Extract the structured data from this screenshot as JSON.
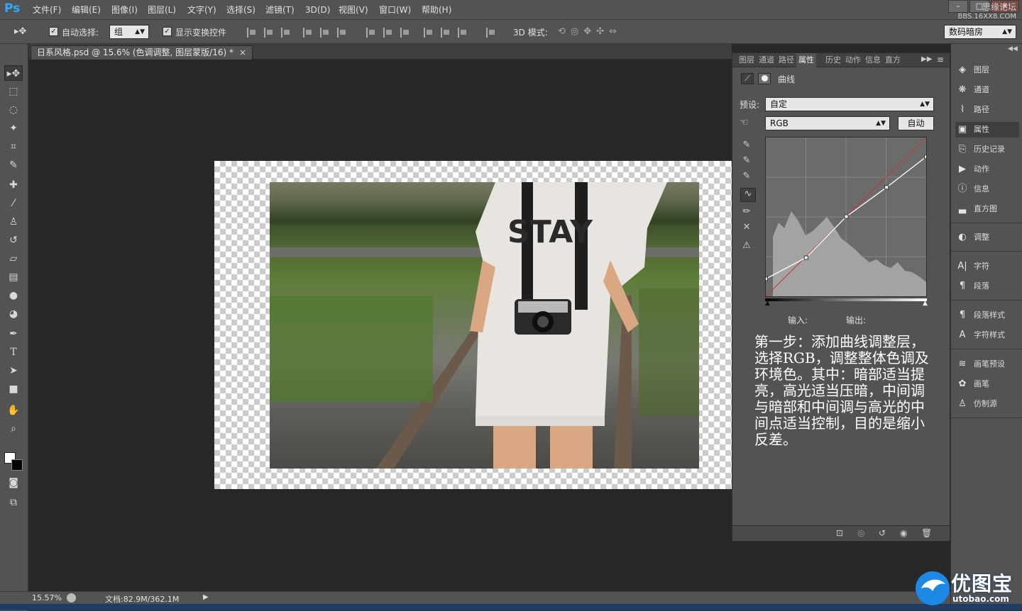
{
  "app": {
    "logo": "Ps"
  },
  "menu": [
    "文件(F)",
    "编辑(E)",
    "图像(I)",
    "图层(L)",
    "文字(Y)",
    "选择(S)",
    "滤镜(T)",
    "3D(D)",
    "视图(V)",
    "窗口(W)",
    "帮助(H)"
  ],
  "window_controls": {
    "minimize": "–",
    "maximize": "□",
    "close": "✕"
  },
  "watermark_top": {
    "line1": "思缘论坛",
    "line2": "BBS.16XX8.COM"
  },
  "options": {
    "auto_select_label": "自动选择:",
    "auto_select_value": "组",
    "show_transform_label": "显示变换控件",
    "mode_3d_label": "3D 模式:",
    "workspace": "数码暗房"
  },
  "document": {
    "tab_title": "日系风格.psd @ 15.6% (色调调整, 图层蒙版/16) *",
    "close": "×"
  },
  "photo": {
    "shirt_text": "STAY"
  },
  "status": {
    "zoom": "15.57%",
    "doc_size": "文档:82.9M/362.1M"
  },
  "properties": {
    "tabs": [
      "图层",
      "通道",
      "路径",
      "属性",
      "历史",
      "动作",
      "信息",
      "直方"
    ],
    "active_tab": "属性",
    "panel_title": "曲线",
    "preset_label": "预设:",
    "preset_value": "自定",
    "channel_value": "RGB",
    "auto_button": "自动",
    "input_label": "输入:",
    "output_label": "输出:",
    "annotation": "第一步：添加曲线调整层，选择RGB，调整整体色调及环境色。其中：暗部适当提亮，高光适当压暗，中间调与暗部和中间调与高光的中间点适当控制，目的是缩小反差。"
  },
  "curve": {
    "points": [
      [
        0,
        28
      ],
      [
        64,
        62
      ],
      [
        128,
        128
      ],
      [
        192,
        175
      ],
      [
        255,
        224
      ]
    ],
    "diagonal": [
      [
        0,
        0
      ],
      [
        255,
        255
      ]
    ]
  },
  "dock": [
    {
      "icon": "layers-icon",
      "label": "图层"
    },
    {
      "icon": "channels-icon",
      "label": "通道"
    },
    {
      "icon": "paths-icon",
      "label": "路径"
    },
    {
      "icon": "properties-icon",
      "label": "属性"
    },
    {
      "icon": "history-icon",
      "label": "历史记录"
    },
    {
      "icon": "actions-icon",
      "label": "动作"
    },
    {
      "icon": "info-icon",
      "label": "信息"
    },
    {
      "icon": "histogram-icon",
      "label": "直方图"
    },
    {
      "icon": "adjustments-icon",
      "label": "调整"
    },
    {
      "icon": "character-icon",
      "label": "字符"
    },
    {
      "icon": "paragraph-icon",
      "label": "段落"
    },
    {
      "icon": "paragraph-styles-icon",
      "label": "段落样式"
    },
    {
      "icon": "character-styles-icon",
      "label": "字符样式"
    },
    {
      "icon": "brush-presets-icon",
      "label": "画笔预设"
    },
    {
      "icon": "brush-icon",
      "label": "画笔"
    },
    {
      "icon": "clone-source-icon",
      "label": "仿制源"
    }
  ],
  "brand_watermark": {
    "name": "优图宝",
    "url": "utobao.com"
  }
}
